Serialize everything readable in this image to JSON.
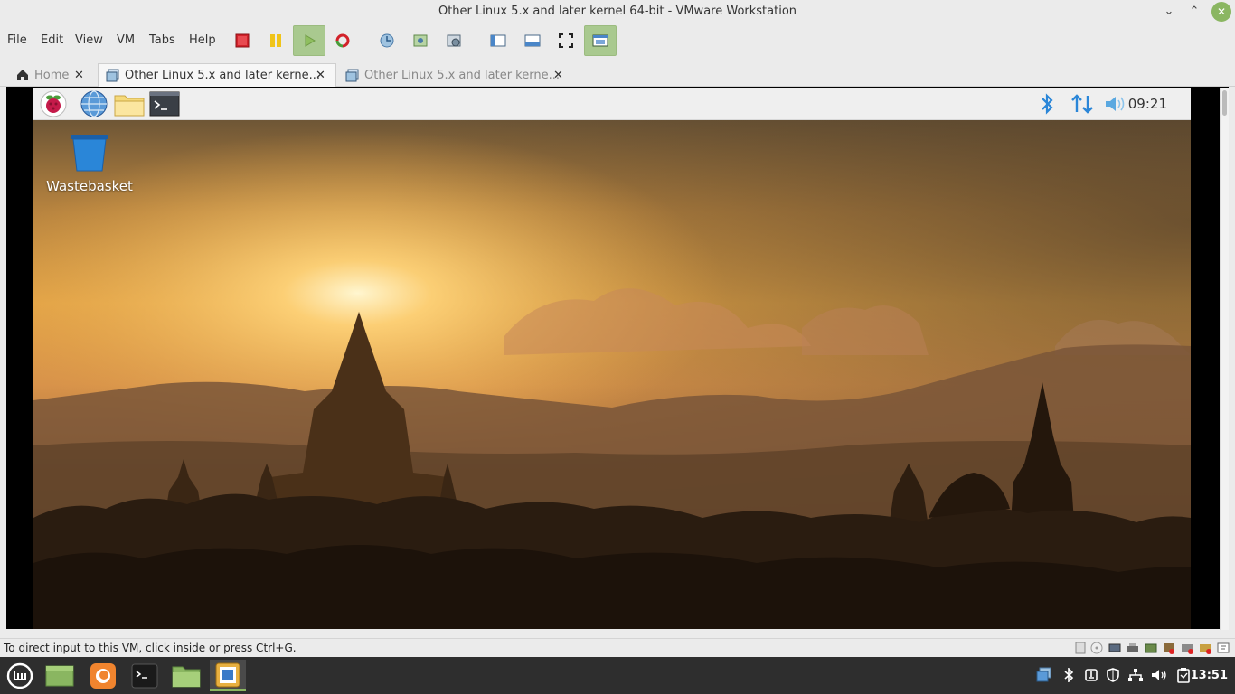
{
  "window": {
    "title": "Other Linux 5.x and later kernel 64-bit - VMware Workstation",
    "controls": [
      "minimize",
      "maximize",
      "close"
    ]
  },
  "menu": {
    "items": [
      "File",
      "Edit",
      "View",
      "VM",
      "Tabs",
      "Help"
    ]
  },
  "toolbar": {
    "buttons": [
      "power-off",
      "suspend",
      "power-on",
      "revert-snapshot",
      "take-snapshot",
      "snapshot-manager",
      "snapshot-settings",
      "show-library",
      "thumbnail-bar",
      "full-screen",
      "unity"
    ],
    "active": "unity"
  },
  "tabs": [
    {
      "label": "Home",
      "icon": "home-icon",
      "active": false
    },
    {
      "label": "Other Linux 5.x and later kerne...",
      "icon": "vm-icon",
      "active": true
    },
    {
      "label": "Other Linux 5.x and later kerne...",
      "icon": "vm-icon",
      "active": false
    }
  ],
  "guest": {
    "panel": {
      "launchers": [
        "raspberry-menu",
        "web-browser",
        "file-manager",
        "terminal"
      ],
      "indicators": [
        "bluetooth",
        "network",
        "volume"
      ],
      "clock": "09:21"
    },
    "desktop": {
      "icons": [
        {
          "label": "Wastebasket",
          "icon": "trash-icon"
        }
      ]
    }
  },
  "status": {
    "message": "To direct input to this VM, click inside or press Ctrl+G.",
    "devices": [
      "hard-disk",
      "cd-dvd",
      "display",
      "printer",
      "network-adapter",
      "usb",
      "sound",
      "network-disconnected",
      "usb-disconnected",
      "message"
    ]
  },
  "taskbar": {
    "apps": [
      "mint-menu",
      "show-desktop",
      "firefox",
      "terminal",
      "files",
      "vmware-workstation"
    ],
    "active": "vmware-workstation",
    "tray": [
      "vmware-tray",
      "bluetooth",
      "update-manager",
      "security",
      "network",
      "volume",
      "clipboard"
    ],
    "clock": "13:51"
  },
  "colors": {
    "accent": "#8ab661",
    "panel": "#efefef",
    "taskbar": "#2e2e2e",
    "sky_top": "#8a6a40",
    "sun": "#fff2c0",
    "silhouette": "#2a1c10"
  }
}
